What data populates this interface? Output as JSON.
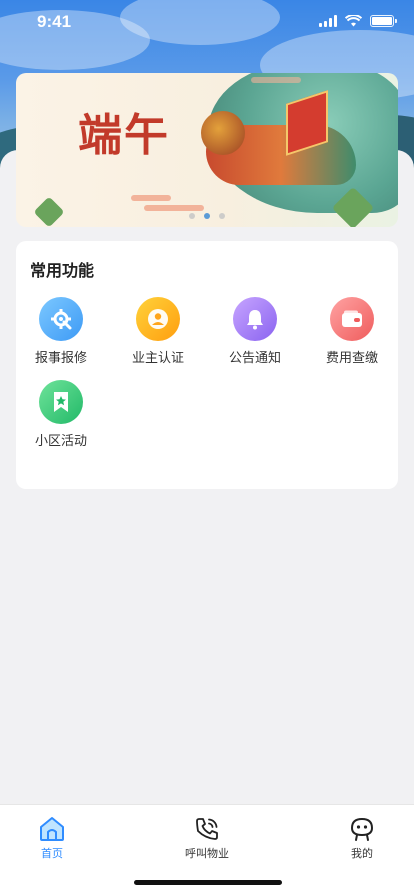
{
  "status_bar": {
    "time": "9:41"
  },
  "banner": {
    "title": "端午",
    "dots": 3,
    "active_dot": 1
  },
  "functions": {
    "title": "常用功能",
    "items": [
      {
        "label": "报事报修",
        "icon": "gear-wrench-icon",
        "color_from": "#7cc8ff",
        "color_to": "#3d9af5"
      },
      {
        "label": "业主认证",
        "icon": "user-icon",
        "color_from": "#ffd23a",
        "color_to": "#ff9e0f"
      },
      {
        "label": "公告通知",
        "icon": "bell-icon",
        "color_from": "#c7a5ff",
        "color_to": "#8a63f0"
      },
      {
        "label": "费用查缴",
        "icon": "wallet-icon",
        "color_from": "#ffa3a3",
        "color_to": "#ef5c5c"
      },
      {
        "label": "小区活动",
        "icon": "star-flag-icon",
        "color_from": "#6fe39a",
        "color_to": "#22b968"
      }
    ]
  },
  "tabbar": {
    "home": "首页",
    "call": "呼叫物业",
    "mine": "我的",
    "active": "home",
    "active_color": "#2f8cff"
  }
}
